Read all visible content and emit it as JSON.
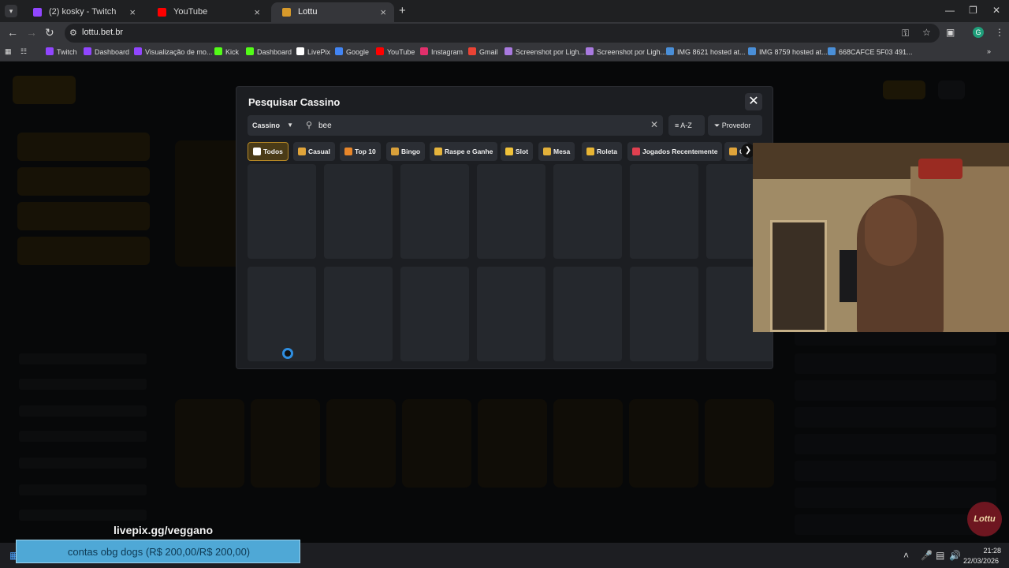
{
  "browser": {
    "tabs": [
      {
        "title": "(2) kosky - Twitch",
        "favicon_color": "#9146ff",
        "active": false
      },
      {
        "title": "YouTube",
        "favicon_color": "#ff0000",
        "active": false
      },
      {
        "title": "Lottu",
        "favicon_color": "#d79a2b",
        "active": true
      }
    ],
    "url": "lottu.bet.br",
    "profile_initial": "G",
    "bookmarks": [
      {
        "label": "Twitch",
        "color": "#9146ff"
      },
      {
        "label": "Dashboard",
        "color": "#9146ff"
      },
      {
        "label": "Visualização de mo...",
        "color": "#9146ff"
      },
      {
        "label": "Kick",
        "color": "#53fc18"
      },
      {
        "label": "Dashboard",
        "color": "#53fc18"
      },
      {
        "label": "LivePix",
        "color": "#ffffff"
      },
      {
        "label": "Google",
        "color": "#4285f4"
      },
      {
        "label": "YouTube",
        "color": "#ff0000"
      },
      {
        "label": "Instagram",
        "color": "#e1306c"
      },
      {
        "label": "Gmail",
        "color": "#ea4335"
      },
      {
        "label": "Screenshot por Ligh...",
        "color": "#a97ae0"
      },
      {
        "label": "Screenshot por Ligh...",
        "color": "#a97ae0"
      },
      {
        "label": "IMG 8621 hosted at...",
        "color": "#4a8fd8"
      },
      {
        "label": "IMG 8759 hosted at...",
        "color": "#4a8fd8"
      },
      {
        "label": "668CAFCE 5F03 491...",
        "color": "#4a8fd8"
      }
    ]
  },
  "modal": {
    "title": "Pesquisar Cassino",
    "close_icon": "close-icon",
    "category": "Cassino",
    "search_value": "bee",
    "sort_label": "A-Z",
    "provider_label": "Provedor",
    "chips": [
      {
        "label": "Todos",
        "color": "#ffffff",
        "active": true
      },
      {
        "label": "Casual",
        "color": "#e0a43a",
        "active": false
      },
      {
        "label": "Top 10",
        "color": "#e8862a",
        "active": false
      },
      {
        "label": "Bingo",
        "color": "#d9a03a",
        "active": false
      },
      {
        "label": "Raspe e Ganhe",
        "color": "#e6b43c",
        "active": false
      },
      {
        "label": "Slot",
        "color": "#f0c23a",
        "active": false
      },
      {
        "label": "Mesa",
        "color": "#e2b03a",
        "active": false
      },
      {
        "label": "Roleta",
        "color": "#e8b534",
        "active": false
      },
      {
        "label": "Jogados Recentemente",
        "color": "#e04050",
        "active": false
      },
      {
        "label": "C",
        "color": "#e0a43a",
        "active": false
      }
    ],
    "loading": true
  },
  "stream": {
    "livepix_label": "livepix.gg/veggano",
    "goal_text": "contas obg dogs (R$ 200,00/R$ 200,00)",
    "goal_progress": 1.0,
    "badge_text": "Lottu"
  },
  "taskbar": {
    "time": "21:28",
    "date": "22/03/2026"
  },
  "colors": {
    "accent": "#b88a26",
    "spinner": "#2f8ee0",
    "goal_bar": "#4fa8d6"
  }
}
